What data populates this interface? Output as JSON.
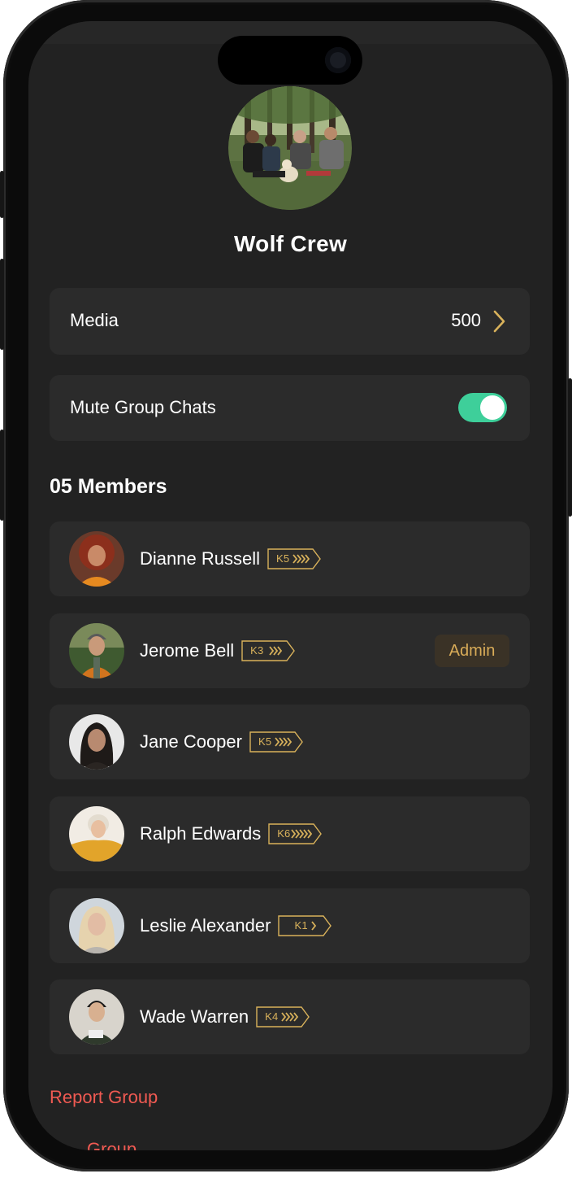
{
  "group": {
    "name": "Wolf Crew",
    "photo_icon": "group-photo"
  },
  "settings": {
    "media_label": "Media",
    "media_count": "500",
    "mute_label": "Mute Group Chats",
    "mute_enabled": true
  },
  "members_header": "05 Members",
  "members": [
    {
      "name": "Dianne Russell",
      "level": "K5",
      "chevrons": 4,
      "admin": false
    },
    {
      "name": "Jerome Bell",
      "level": "K3",
      "chevrons": 3,
      "admin": true
    },
    {
      "name": "Jane Cooper",
      "level": "K5",
      "chevrons": 4,
      "admin": false
    },
    {
      "name": "Ralph Edwards",
      "level": "K6",
      "chevrons": 5,
      "admin": false
    },
    {
      "name": "Leslie Alexander",
      "level": "K1",
      "chevrons": 1,
      "admin": false
    },
    {
      "name": "Wade Warren",
      "level": "K4",
      "chevrons": 4,
      "admin": false
    }
  ],
  "admin_label": "Admin",
  "actions": {
    "report_label": "Report Group",
    "leave_label": "Group"
  },
  "colors": {
    "background": "#222222",
    "card": "#2b2b2b",
    "toggle_on": "#3ecf9a",
    "badge_gold": "#d9b25b",
    "danger": "#f05a52"
  }
}
